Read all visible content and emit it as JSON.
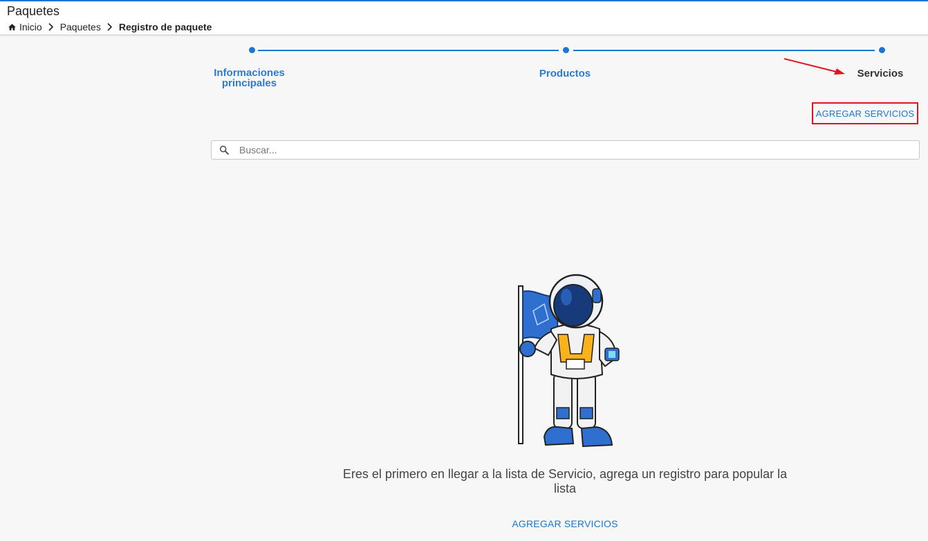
{
  "header": {
    "title": "Paquetes",
    "breadcrumb": {
      "home": "Inicio",
      "section": "Paquetes",
      "current": "Registro de paquete"
    }
  },
  "stepper": {
    "steps": [
      {
        "label": "Informaciones principales",
        "state": "completed"
      },
      {
        "label": "Productos",
        "state": "completed"
      },
      {
        "label": "Servicios",
        "state": "active"
      }
    ]
  },
  "actions": {
    "add_top_label": "AGREGAR SERVICIOS",
    "add_bottom_label": "AGREGAR SERVICIOS"
  },
  "search": {
    "placeholder": "Buscar...",
    "value": ""
  },
  "empty_state": {
    "message": "Eres el primero en llegar a la lista de Servicio, agrega un registro para popular la lista",
    "illustration": "astronaut-with-flag"
  },
  "colors": {
    "accent": "#1976d2",
    "highlight_box": "#e0141e",
    "background": "#f7f7f7"
  },
  "icons": {
    "home": "home-icon",
    "breadcrumb_separator": "chevron-right-icon",
    "search": "search-icon"
  }
}
